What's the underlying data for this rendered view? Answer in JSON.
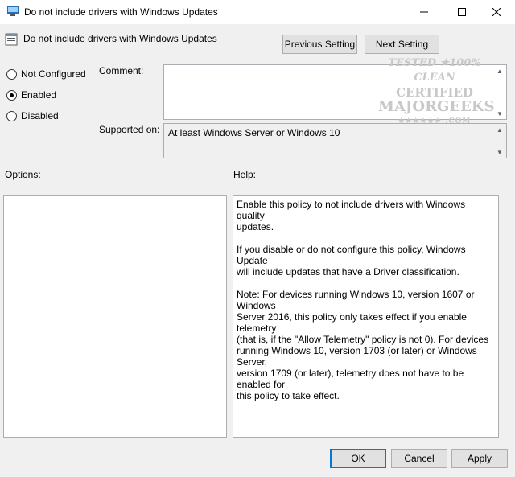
{
  "window": {
    "title": "Do not include drivers with Windows Updates",
    "controls": [
      "minimize-icon",
      "maximize-icon",
      "close-icon"
    ]
  },
  "header": {
    "title": "Do not include drivers with Windows Updates",
    "previous_label": "Previous Setting",
    "next_label": "Next Setting"
  },
  "state": {
    "options": [
      {
        "label": "Not Configured",
        "checked": false
      },
      {
        "label": "Enabled",
        "checked": true
      },
      {
        "label": "Disabled",
        "checked": false
      }
    ]
  },
  "comment": {
    "label": "Comment:",
    "value": ""
  },
  "supported": {
    "label": "Supported on:",
    "value": "At least Windows Server or Windows 10"
  },
  "options_panel": {
    "label": "Options:"
  },
  "help": {
    "label": "Help:",
    "text": "Enable this policy to not include drivers with Windows quality\nupdates.\n\nIf you disable or do not configure this policy, Windows Update\nwill include updates that have a Driver classification.\n\nNote: For devices running Windows 10, version 1607 or Windows\nServer 2016, this policy only takes effect if you enable telemetry\n(that is, if the \"Allow Telemetry\" policy is not 0). For devices\nrunning Windows 10, version 1703 (or later) or Windows Server,\nversion 1709 (or later), telemetry does not have to be enabled for\nthis policy to take effect."
  },
  "footer": {
    "ok_label": "OK",
    "cancel_label": "Cancel",
    "apply_label": "Apply"
  },
  "watermark": {
    "line1": "TESTED ★100% CLEAN",
    "line2": "CERTIFIED",
    "line3": "MAJORGEEKS",
    "line4": "★★★★★★ .COM"
  },
  "colors": {
    "accent": "#0078d7",
    "dialog_bg": "#f0f0f0"
  }
}
